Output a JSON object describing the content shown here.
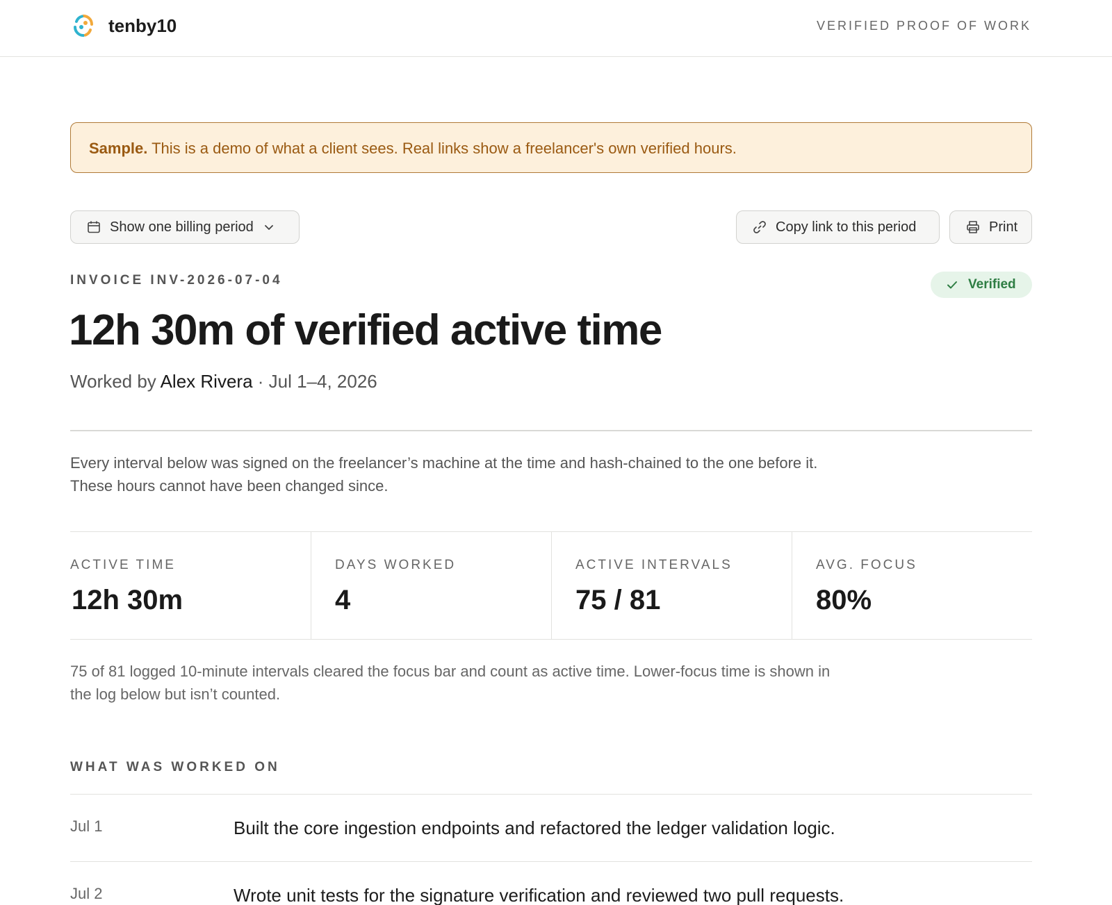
{
  "header": {
    "brand": "tenby10",
    "tagline": "VERIFIED PROOF OF WORK",
    "logo_icon": "tenby10-logo-icon"
  },
  "banner": {
    "bold": "Sample.",
    "text": " This is a demo of what a client sees. Real links show a freelancer's own verified hours."
  },
  "toolbar": {
    "period_label": "Show one billing period",
    "copy_label": "Copy link to this period",
    "print_label": "Print"
  },
  "invoice": {
    "label": "INVOICE INV-2026-07-04",
    "badge": "Verified",
    "headline": "12h 30m of verified active time",
    "worked_prefix": "Worked by ",
    "worker": "Alex Rivera",
    "period": " · Jul 1–4, 2026"
  },
  "intro": "Every interval below was signed on the freelancer’s machine at the time and hash-chained to the one before it. These hours cannot have been changed since.",
  "stats": [
    {
      "label": "ACTIVE TIME",
      "value": "12h 30m"
    },
    {
      "label": "DAYS WORKED",
      "value": "4"
    },
    {
      "label": "ACTIVE INTERVALS",
      "value": "75 / 81"
    },
    {
      "label": "AVG. FOCUS",
      "value": "80%"
    }
  ],
  "note": "75 of 81 logged 10-minute intervals cleared the focus bar and count as active time. Lower-focus time is shown in the log below but isn’t counted.",
  "worked_on": {
    "label": "WHAT WAS WORKED ON",
    "rows": [
      {
        "date": "Jul 1",
        "desc": "Built the core ingestion endpoints and refactored the ledger validation logic."
      },
      {
        "date": "Jul 2",
        "desc": "Wrote unit tests for the signature verification and reviewed two pull requests."
      }
    ]
  },
  "colors": {
    "banner_bg": "#fdf0dc",
    "banner_border": "#b07a37",
    "banner_text": "#9a5a12",
    "verified_bg": "#e6f4e9",
    "verified_text": "#2e7d43",
    "logo_orange": "#f2a93b",
    "logo_teal": "#2fb3cf"
  }
}
